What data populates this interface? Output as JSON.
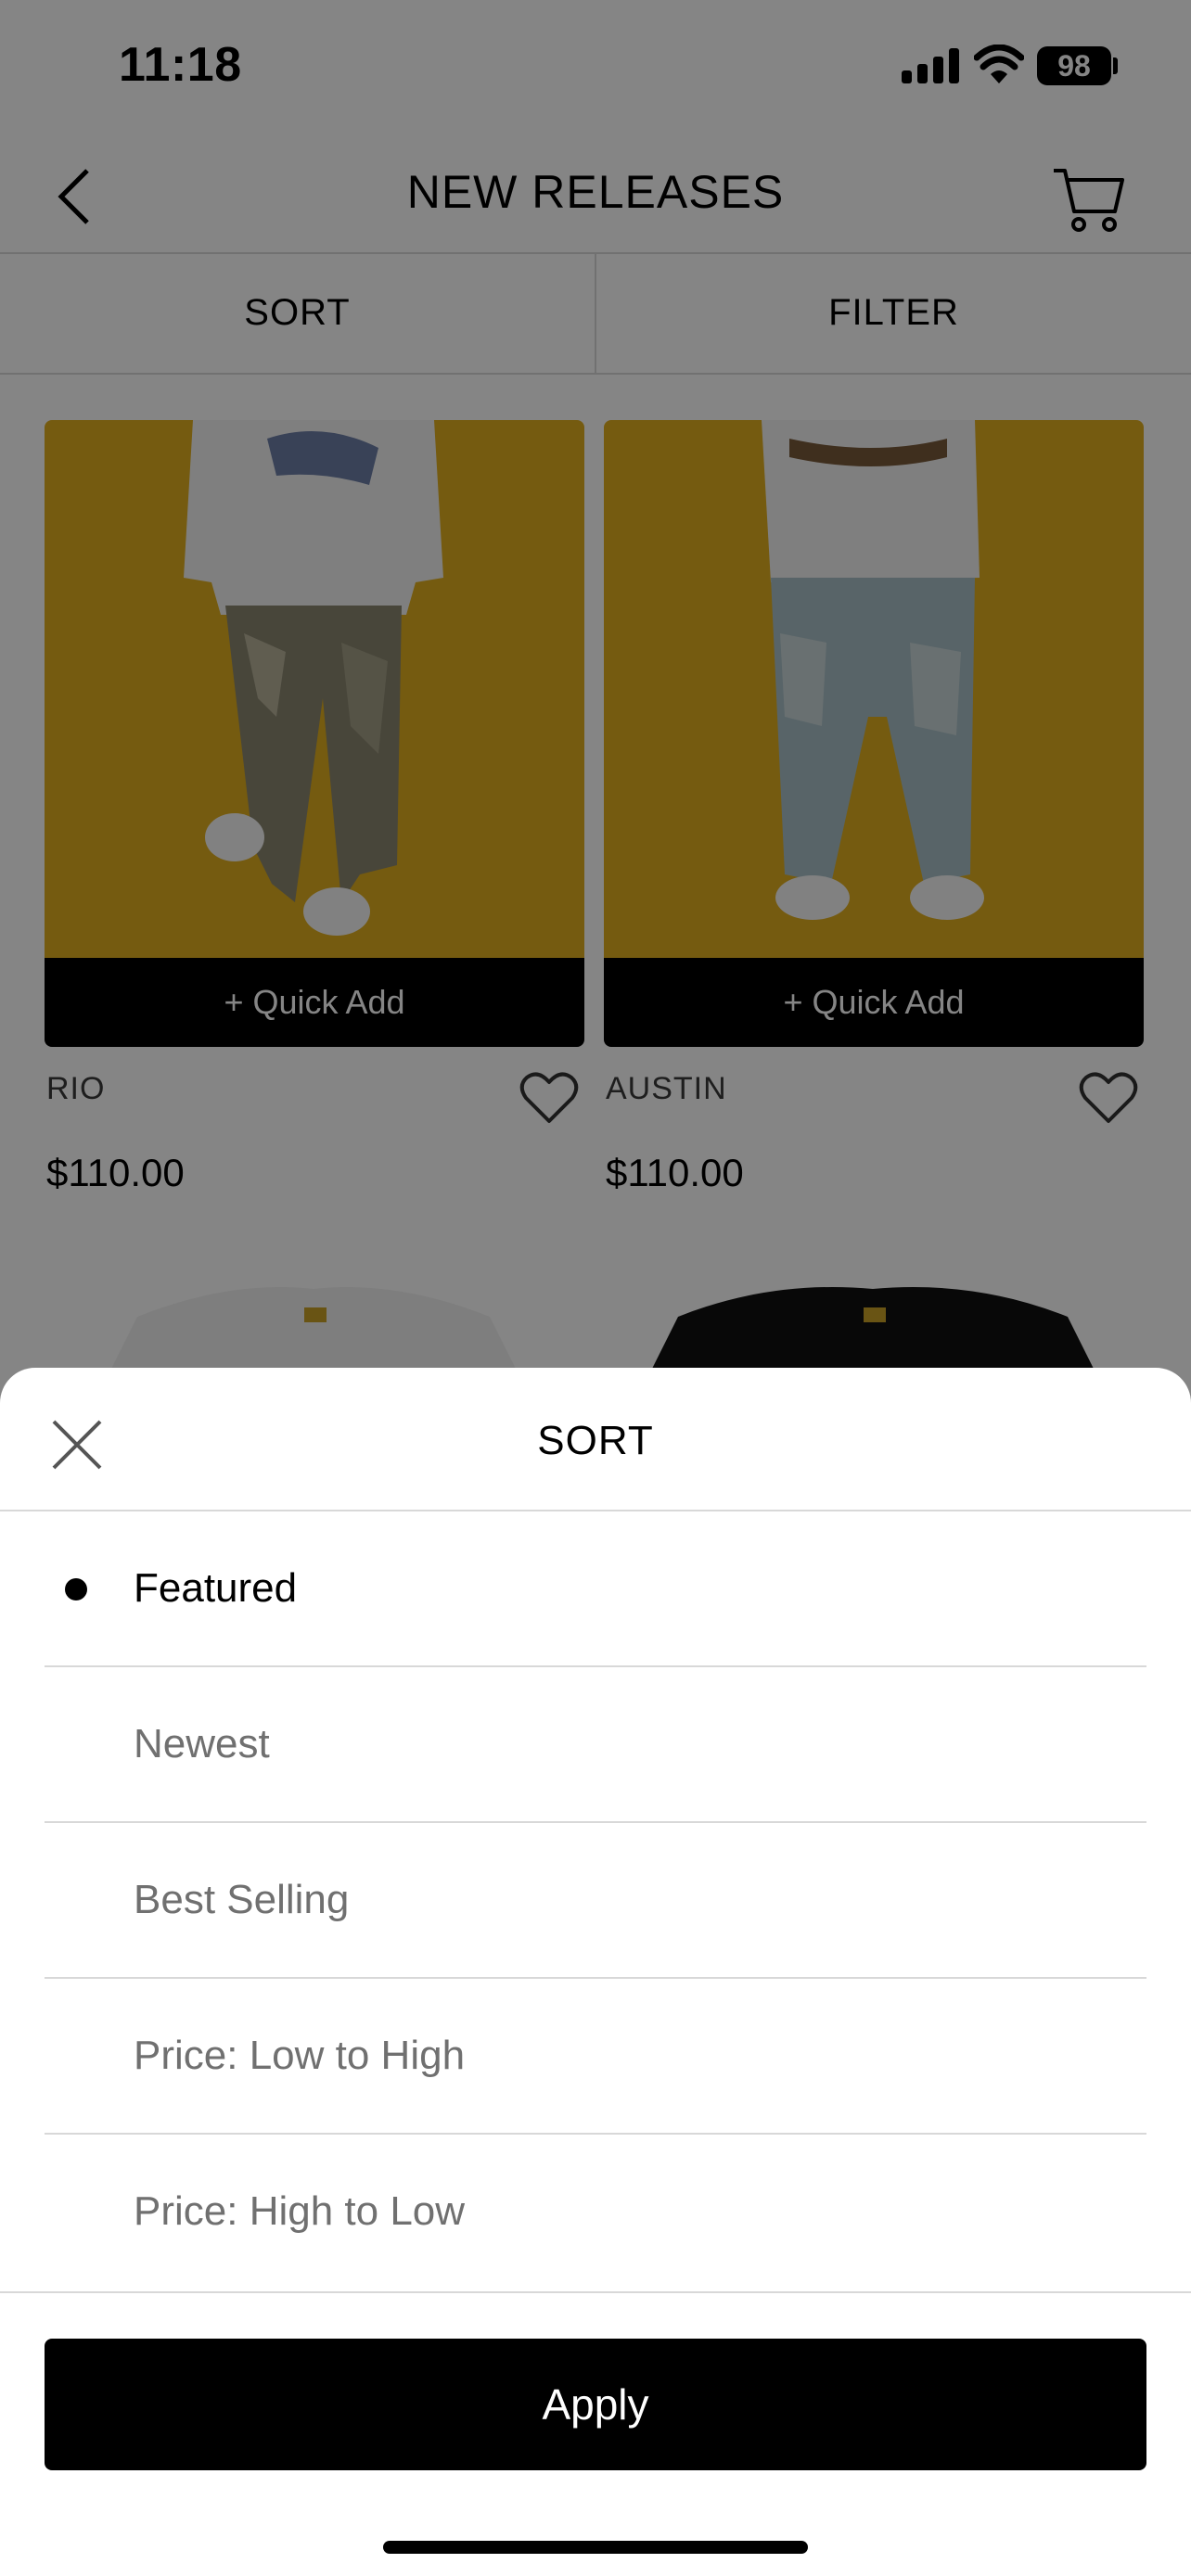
{
  "status_bar": {
    "time": "11:18",
    "battery": "98"
  },
  "header": {
    "title": "NEW RELEASES",
    "back_icon": "chevron-left-icon",
    "cart_icon": "cart-icon"
  },
  "toolbar": {
    "sort_label": "SORT",
    "filter_label": "FILTER"
  },
  "products": [
    {
      "name": "RIO",
      "price": "$110.00",
      "quick_add": "+ Quick Add"
    },
    {
      "name": "AUSTIN",
      "price": "$110.00",
      "quick_add": "+ Quick Add"
    }
  ],
  "sort_sheet": {
    "title": "SORT",
    "options": [
      {
        "label": "Featured",
        "selected": true
      },
      {
        "label": "Newest",
        "selected": false
      },
      {
        "label": "Best Selling",
        "selected": false
      },
      {
        "label": "Price: Low to High",
        "selected": false
      },
      {
        "label": "Price: High to Low",
        "selected": false
      }
    ],
    "apply_label": "Apply"
  },
  "colors": {
    "accent": "#000000",
    "photo_background": "#e1ae1f",
    "overlay": "rgba(0,0,0,0.48)"
  }
}
